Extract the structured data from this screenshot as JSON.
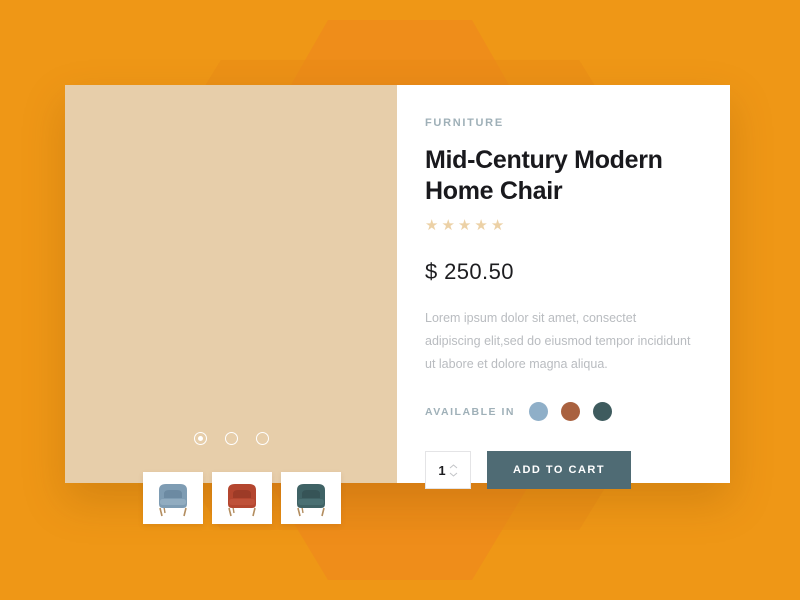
{
  "background": {
    "color": "#ef9716",
    "shape_color": "#ee8b1b"
  },
  "product": {
    "category": "FURNITURE",
    "title": "Mid-Century Modern Home Chair",
    "title_line1": "Mid-Century Modern",
    "title_line2": "Home Chair",
    "rating": 5,
    "rating_max": 5,
    "star_glyph": "★",
    "star_color": "#ecd1a6",
    "price": "$ 250.50",
    "description": "Lorem ipsum dolor sit amet, consectet adipiscing elit,sed do eiusmod tempor incididunt ut labore et dolore magna aliqua.",
    "available_label": "AVAILABLE IN",
    "colors": [
      {
        "name": "dusty-blue",
        "hex": "#8fafc8"
      },
      {
        "name": "terracotta",
        "hex": "#a9613f"
      },
      {
        "name": "dark-teal",
        "hex": "#3e5b5e"
      }
    ]
  },
  "gallery": {
    "panel_color": "#e7ceaa",
    "active_index": 0,
    "dots": [
      {
        "active": true
      },
      {
        "active": false
      },
      {
        "active": false
      }
    ],
    "thumbnails": [
      {
        "name": "chair-blue",
        "body": "#7e9cb3",
        "shade": "#6c8aa2",
        "leg": "#b38d5f"
      },
      {
        "name": "chair-rust",
        "body": "#b4462f",
        "shade": "#9d3b27",
        "leg": "#b38d5f"
      },
      {
        "name": "chair-teal",
        "body": "#3f6265",
        "shade": "#365457",
        "leg": "#b38d5f"
      }
    ]
  },
  "actions": {
    "quantity": "1",
    "add_to_cart_label": "ADD TO CART",
    "add_to_cart_color": "#4f6b74"
  }
}
